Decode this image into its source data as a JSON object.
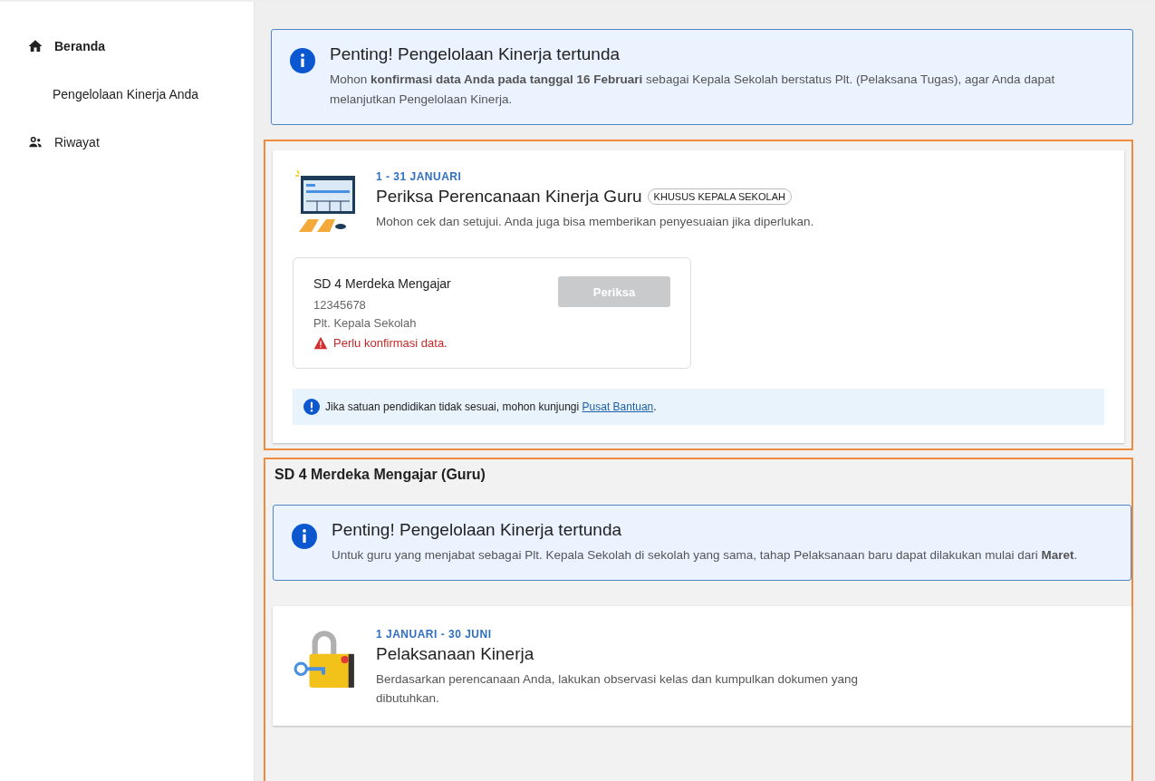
{
  "sidebar": {
    "items": [
      {
        "label": "Beranda",
        "kind": "home",
        "selected": true
      },
      {
        "label": "Pengelolaan Kinerja Anda",
        "kind": "sub",
        "selected": false
      },
      {
        "label": "Riwayat",
        "kind": "history",
        "selected": false
      }
    ]
  },
  "alert_top": {
    "title": "Penting! Pengelolaan Kinerja tertunda",
    "text": "Mohon **konfirmasi data Anda pada tanggal 16 Februari** sebagai Kepala Sekolah berstatus Plt. (Pelaksana Tugas), agar Anda dapat melanjutkan Pengelolaan Kinerja."
  },
  "review_card": {
    "date": "1 - 31 JANUARI",
    "title": "Periksa Perencanaan Kinerja Guru",
    "badge": "KHUSUS KEPALA SEKOLAH",
    "text": "Mohon cek dan setujui. Anda juga bisa memberikan penyesuaian jika diperlukan.",
    "school": {
      "name": "SD 4 Merdeka Mengajar",
      "id": "12345678",
      "role": "Plt. Kepala Sekolah",
      "warning": "Perlu konfirmasi data.",
      "button": {
        "label": "Periksa",
        "disabled": true
      }
    },
    "help": {
      "text": "Jika satuan pendidikan tidak sesuai, mohon kunjungi ",
      "link": "Pusat Bantuan",
      "after": "."
    }
  },
  "section": {
    "title": "SD 4 Merdeka Mengajar (Guru)",
    "alert": {
      "title": "Penting! Pengelolaan Kinerja tertunda",
      "text": "Untuk guru yang menjabat sebagai Plt. Kepala Sekolah di sekolah yang sama, tahap Pelaksanaan baru dapat dilakukan mulai dari **Maret**."
    },
    "card": {
      "date": "1 JANUARI - 30 JUNI",
      "title": "Pelaksanaan Kinerja",
      "text": "Berdasarkan perencanaan Anda, lakukan observasi kelas dan kumpulkan dokumen yang dibutuhkan."
    }
  }
}
